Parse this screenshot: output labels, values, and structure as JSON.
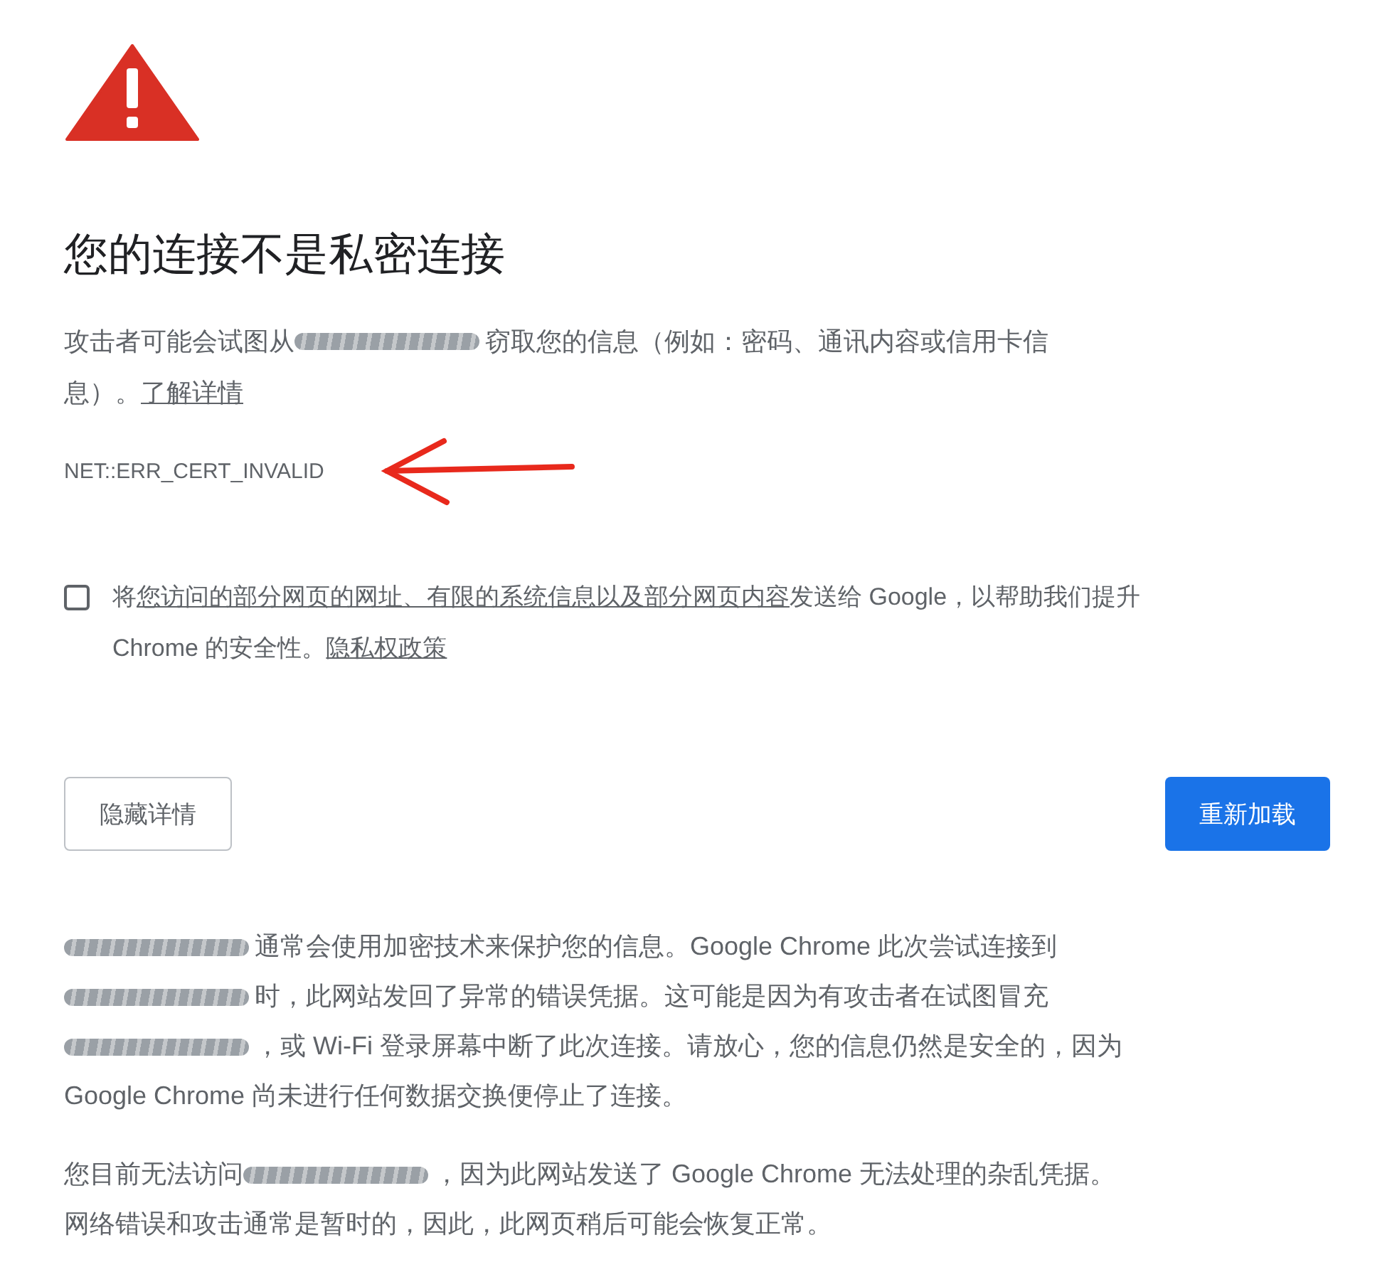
{
  "heading": "您的连接不是私密连接",
  "intro": [
    [
      {
        "kind": "text",
        "text": "攻击者可能会试图从"
      },
      {
        "kind": "redacted"
      },
      {
        "kind": "text",
        "text": "窃取您的信息（例如：密码、通讯内容或信用卡信"
      }
    ],
    [
      {
        "kind": "text",
        "text": "息）。"
      },
      {
        "kind": "link",
        "text": "了解详情"
      }
    ]
  ],
  "error_code": "NET::ERR_CERT_INVALID",
  "report": {
    "checked": false,
    "lines": [
      [
        {
          "kind": "text",
          "text": "将"
        },
        {
          "kind": "link",
          "text": "您访问的部分网页的网址、有限的系统信息以及部分网页内容"
        },
        {
          "kind": "text",
          "text": "发送给 Google，以帮助我们提升"
        }
      ],
      [
        {
          "kind": "text",
          "text": "Chrome 的安全性。"
        },
        {
          "kind": "link",
          "text": "隐私权政策"
        }
      ]
    ]
  },
  "buttons": [
    {
      "kind": "secondary",
      "label": "隐藏详情"
    },
    {
      "kind": "primary",
      "label": "重新加载"
    }
  ],
  "details": [
    [
      [
        {
          "kind": "redacted"
        },
        {
          "kind": "text",
          "text": "通常会使用加密技术来保护您的信息。Google Chrome 此次尝试连接到"
        }
      ],
      [
        {
          "kind": "redacted"
        },
        {
          "kind": "text",
          "text": "时，此网站发回了异常的错误凭据。这可能是因为有攻击者在试图冒充"
        }
      ],
      [
        {
          "kind": "redacted"
        },
        {
          "kind": "text",
          "text": "，或 Wi-Fi 登录屏幕中断了此次连接。请放心，您的信息仍然是安全的，因为"
        }
      ],
      [
        {
          "kind": "text",
          "text": "Google Chrome 尚未进行任何数据交换便停止了连接。"
        }
      ]
    ],
    [
      [
        {
          "kind": "text",
          "text": "您目前无法访问"
        },
        {
          "kind": "redacted"
        },
        {
          "kind": "text",
          "text": "，因为此网站发送了 Google Chrome 无法处理的杂乱凭据。"
        }
      ],
      [
        {
          "kind": "text",
          "text": "网络错误和攻击通常是暂时的，因此，此网页稍后可能会恢复正常。"
        }
      ]
    ]
  ]
}
